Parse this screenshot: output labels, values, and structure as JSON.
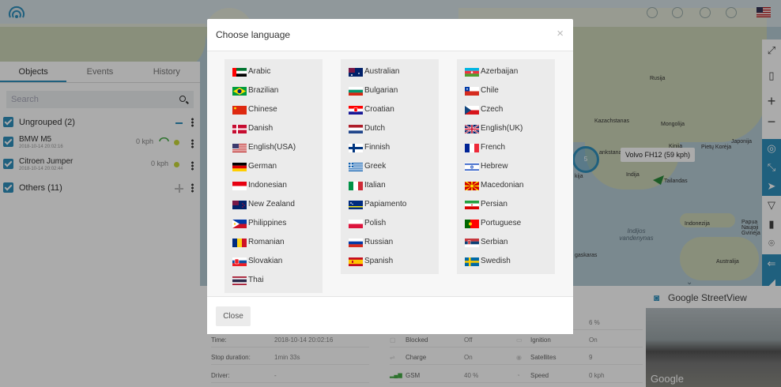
{
  "map": {
    "labels": [
      "Rusija",
      "Kazachstanas",
      "Mongolija",
      "Kinija",
      "Pietų Korėja",
      "Japonija",
      "Indija",
      "ankstanas",
      "Tailandas",
      "Indonezija",
      "Papua Naujoji Gvinėja",
      "Indijos vandenynas",
      "Australija",
      "gaskaras",
      "kija"
    ],
    "cluster_count": "5",
    "vehicle_callout": "Volvo FH12 (59 kph)"
  },
  "sidebar": {
    "tabs": [
      "Objects",
      "Events",
      "History"
    ],
    "search_placeholder": "Search",
    "groups": [
      {
        "label": "Ungrouped (2)"
      },
      {
        "label": "Others (11)"
      }
    ],
    "objects": [
      {
        "name": "BMW M5",
        "date": "2018-10-14 20:02:16",
        "speed": "0 kph"
      },
      {
        "name": "Citroen Jumper",
        "date": "2018-10-14 20:02:44",
        "speed": "0 kph"
      }
    ]
  },
  "info": {
    "rows": [
      {
        "key": "Time:",
        "value": "2018-10-14 20:02:16"
      },
      {
        "key": "Stop duration:",
        "value": "1min 33s"
      },
      {
        "key": "Driver:",
        "value": "-"
      }
    ],
    "sensors": [
      {
        "key": "",
        "value": "",
        "key2": "",
        "value2": "6 %"
      },
      {
        "key": "Blocked",
        "value": "Off",
        "key2": "Ignition",
        "value2": "On"
      },
      {
        "key": "Charge",
        "value": "On",
        "key2": "Satellites",
        "value2": "9"
      },
      {
        "key": "GSM",
        "value": "40 %",
        "key2": "Speed",
        "value2": "0 kph"
      }
    ]
  },
  "street": {
    "title": "Google StreetView",
    "logo": "Google"
  },
  "modal": {
    "title": "Choose language",
    "close_label": "Close",
    "columns": [
      [
        "Arabic",
        "Brazilian",
        "Chinese",
        "Danish",
        "English(USA)",
        "German",
        "Indonesian",
        "New Zealand",
        "Philippines",
        "Romanian",
        "Slovakian",
        "Thai"
      ],
      [
        "Australian",
        "Bulgarian",
        "Croatian",
        "Dutch",
        "Finnish",
        "Greek",
        "Italian",
        "Papiamento",
        "Polish",
        "Russian",
        "Spanish"
      ],
      [
        "Azerbaijan",
        "Chile",
        "Czech",
        "English(UK)",
        "French",
        "Hebrew",
        "Macedonian",
        "Persian",
        "Portuguese",
        "Serbian",
        "Swedish"
      ]
    ],
    "flags": [
      [
        "ae",
        "br",
        "cn",
        "dk",
        "us",
        "de",
        "id",
        "nz",
        "ph",
        "ro",
        "sk",
        "th"
      ],
      [
        "au",
        "bg",
        "hr",
        "nl",
        "fi",
        "gr",
        "it",
        "cw",
        "pl",
        "ru",
        "es"
      ],
      [
        "az",
        "cl",
        "cz",
        "gb",
        "fr",
        "il",
        "mk",
        "ir",
        "pt",
        "rs",
        "se"
      ]
    ]
  },
  "colors": {
    "accent": "#2f8fbd",
    "status_green": "#c8d83a"
  }
}
